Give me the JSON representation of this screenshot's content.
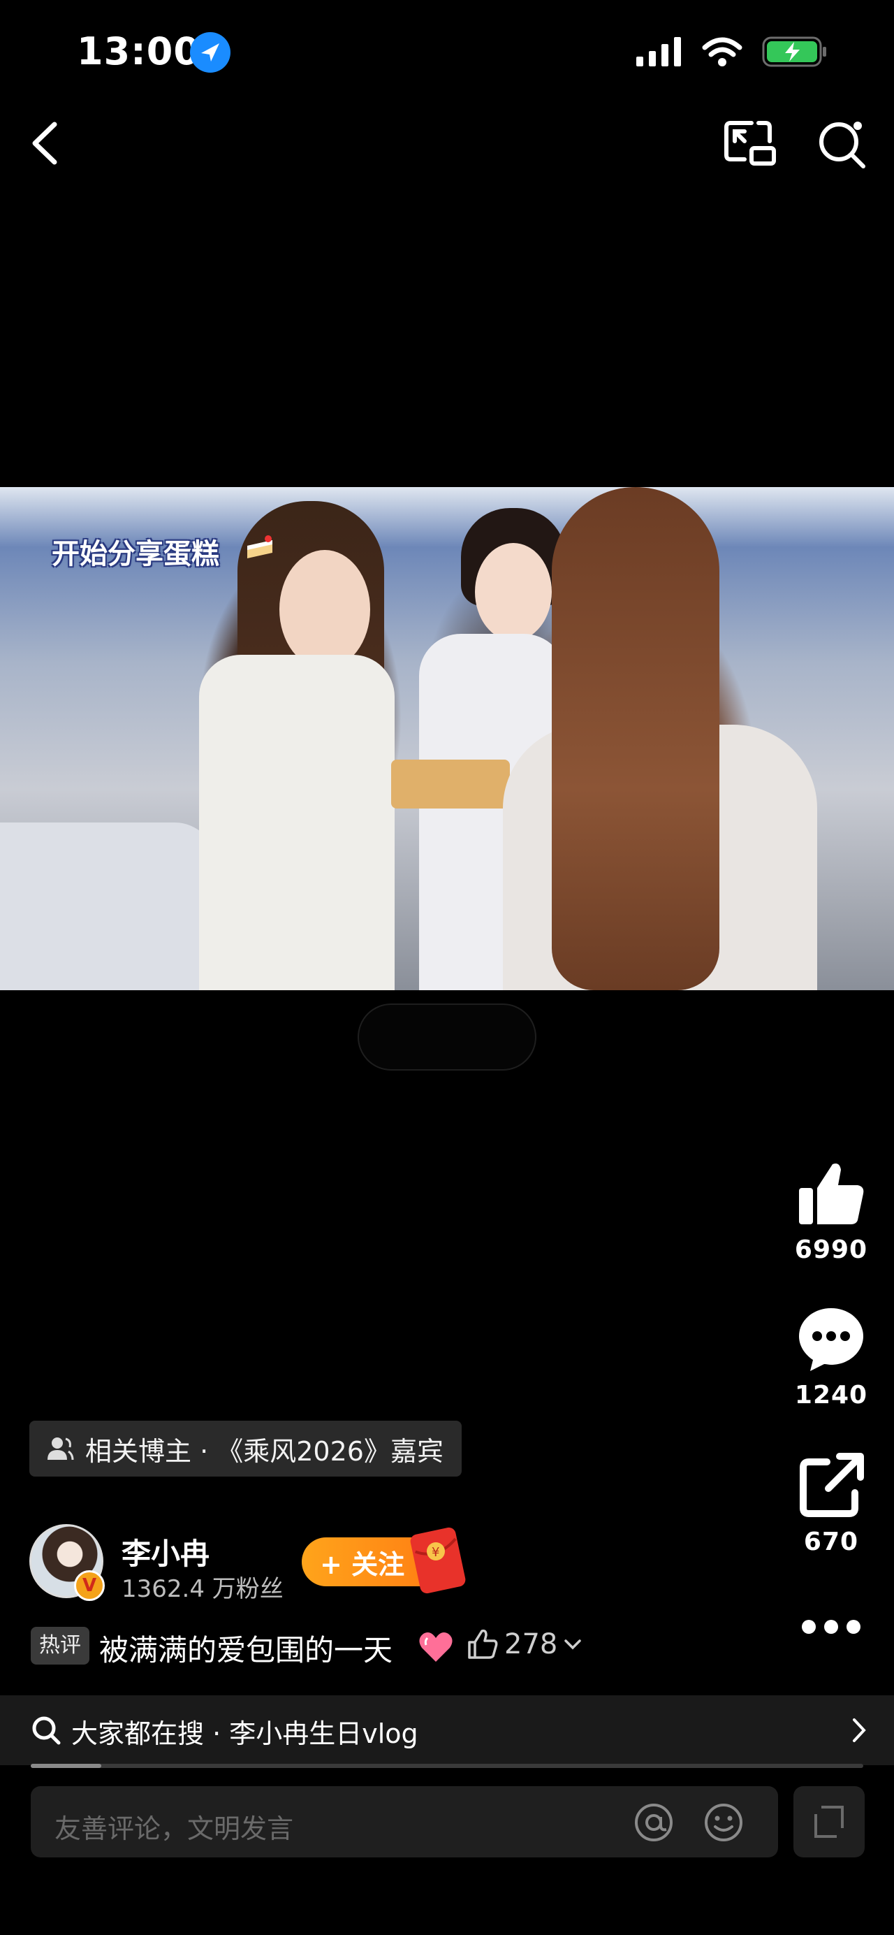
{
  "status_bar": {
    "time": "13:00"
  },
  "video": {
    "caption": "开始分享蛋糕",
    "faint_pill": ""
  },
  "actions": {
    "like_count": "6990",
    "comment_count": "1240",
    "share_count": "670"
  },
  "related": {
    "label": "相关博主 · 《乘风2026》嘉宾"
  },
  "author": {
    "name": "李小冉",
    "fans": "1362.4 万粉丝",
    "follow_label": "+ 关注"
  },
  "hot_comment": {
    "tag": "热评",
    "text": "被满满的爱包围的一天",
    "likes": "278"
  },
  "search_suggest": {
    "text": "大家都在搜 · 李小冉生日vlog"
  },
  "progress": {
    "fraction": 0.085
  },
  "comment_input": {
    "placeholder": "友善评论，文明发言"
  },
  "colors": {
    "follow": "#ff8a18",
    "background": "#000000",
    "location_badge": "#1a8cff"
  },
  "icons": [
    "back-icon",
    "picture-in-picture-icon",
    "search-icon",
    "thumbs-up-icon",
    "comment-bubble-icon",
    "share-icon",
    "more-icon",
    "at-icon",
    "emoji-icon",
    "expand-icon",
    "red-packet-icon",
    "heart-icon",
    "chevron-right-icon"
  ]
}
